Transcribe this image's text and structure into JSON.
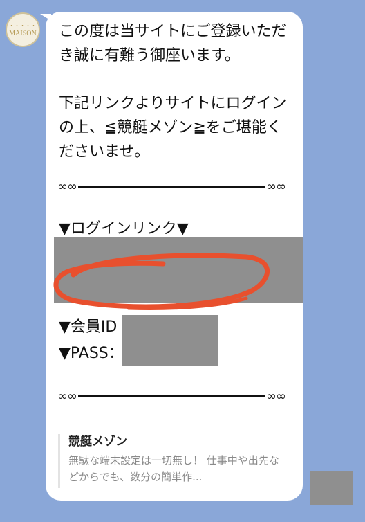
{
  "avatar": {
    "brand_small": "・・・・・",
    "brand": "MAISON"
  },
  "message": {
    "para1": "この度は当サイトにご登録いただき誠に有難う御座います。",
    "para2": "下記リンクよりサイトにログインの上、≦競艇メゾン≧をご堪能くださいませ。",
    "divider_end_left": "∞∞",
    "divider_end_right": "∞∞",
    "link_label": "▼ログインリンク▼",
    "id_label": "▼会員ID",
    "pass_label": "▼PASS："
  },
  "preview": {
    "title": "競艇メゾン",
    "body": "無駄な端末設定は一切無し！ 仕事中や出先などからでも、数分の簡単作..."
  },
  "colors": {
    "background": "#8aa7d8",
    "bubble": "#ffffff",
    "redaction": "#8f8f8f",
    "scribble": "#e8502e"
  }
}
